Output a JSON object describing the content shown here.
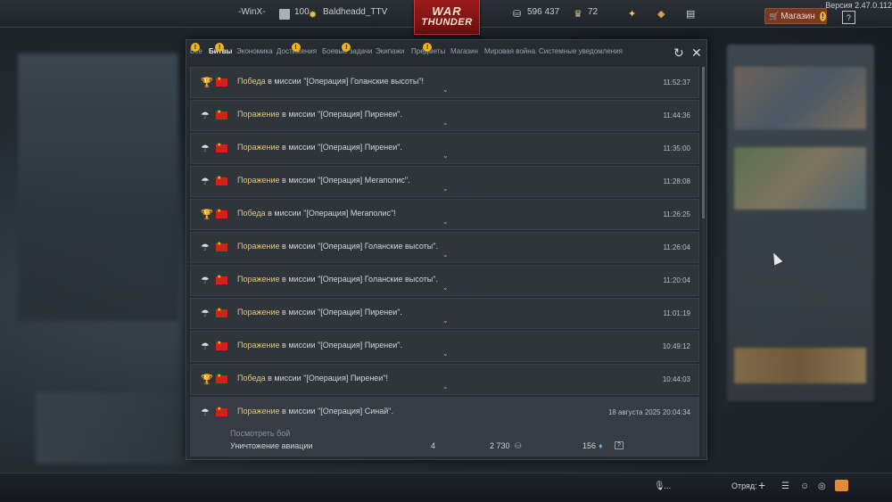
{
  "header": {
    "clan": "-WinX-",
    "level": "100",
    "username": "Baldheadd_TTV",
    "logo_line1": "WAR",
    "logo_line2": "THUNDER",
    "silver": "596 437",
    "gold": "72",
    "shop_label": "Магазин",
    "help_label": "?",
    "version": "Версия 2.47.0.112"
  },
  "tabs": [
    {
      "label": "Все",
      "warn": true
    },
    {
      "label": "Битвы",
      "warn": true,
      "active": true
    },
    {
      "label": "Экономика",
      "warn": false
    },
    {
      "label": "Достижения",
      "warn": true
    },
    {
      "label": "Боевые задачи",
      "warn": true
    },
    {
      "label": "Экипажи",
      "warn": false
    },
    {
      "label": "Предметы",
      "warn": true
    },
    {
      "label": "Магазин",
      "warn": false
    },
    {
      "label": "Мировая война",
      "warn": false
    },
    {
      "label": "Системные уведомления",
      "warn": false
    }
  ],
  "tab_warn_glyph": "!",
  "controls": {
    "refresh": "↻",
    "close": "✕"
  },
  "mission_word": "в миссии",
  "battles": [
    {
      "result": "Победа",
      "type": "victory",
      "mission": "\"[Операция] Голанские высоты\"!",
      "time": "11:52:37"
    },
    {
      "result": "Поражение",
      "type": "defeat",
      "mission": "\"[Операция] Пиренеи\".",
      "time": "11:44:36"
    },
    {
      "result": "Поражение",
      "type": "defeat",
      "mission": "\"[Операция] Пиренеи\".",
      "time": "11:35:00"
    },
    {
      "result": "Поражение",
      "type": "defeat",
      "mission": "\"[Операция] Мегаполис\".",
      "time": "11:28:08"
    },
    {
      "result": "Победа",
      "type": "victory",
      "mission": "\"[Операция] Мегаполис\"!",
      "time": "11:26:25"
    },
    {
      "result": "Поражение",
      "type": "defeat",
      "mission": "\"[Операция] Голанские высоты\".",
      "time": "11:26:04"
    },
    {
      "result": "Поражение",
      "type": "defeat",
      "mission": "\"[Операция] Голанские высоты\".",
      "time": "11:20:04"
    },
    {
      "result": "Поражение",
      "type": "defeat",
      "mission": "\"[Операция] Пиренеи\".",
      "time": "11:01:19"
    },
    {
      "result": "Поражение",
      "type": "defeat",
      "mission": "\"[Операция] Пиренеи\".",
      "time": "10:49:12"
    },
    {
      "result": "Победа",
      "type": "victory",
      "mission": "\"[Операция] Пиренеи\"!",
      "time": "10:44:03"
    },
    {
      "result": "Поражение",
      "type": "defeat",
      "mission": "\"[Операция] Синай\".",
      "time": "18 августа 2025 20:04:34",
      "expanded": true,
      "view_battle": "Посмотреть бой",
      "stats": {
        "label": "Уничтожение авиации",
        "count": "4",
        "silver": "2 730",
        "research": "156",
        "help": "?"
      }
    }
  ],
  "bottom": {
    "mic_label": "...",
    "squad_label": "Отряд:"
  }
}
